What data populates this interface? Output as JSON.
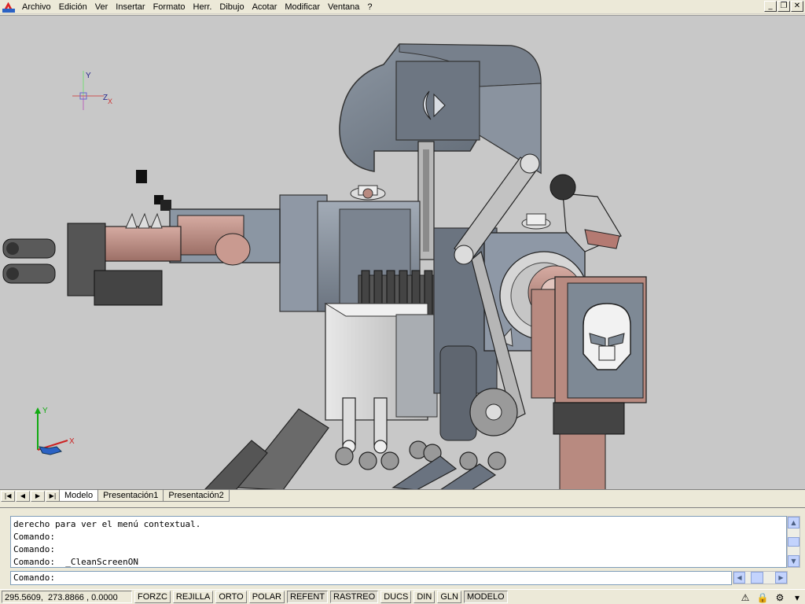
{
  "menu": [
    "Archivo",
    "Edición",
    "Ver",
    "Insertar",
    "Formato",
    "Herr.",
    "Dibujo",
    "Acotar",
    "Modificar",
    "Ventana",
    "?"
  ],
  "window_controls": {
    "minimize": "_",
    "restore": "❐",
    "close": "✕"
  },
  "viewport": {
    "background": "#c8c8c8",
    "ucs_top": {
      "y": "Y",
      "z": "Z",
      "x": "X"
    },
    "ucs_bottom": {
      "y": "Y",
      "x": "X"
    }
  },
  "tab_nav": [
    "|◀",
    "◀",
    "▶",
    "▶|"
  ],
  "tabs": [
    "Modelo",
    "Presentación1",
    "Presentación2"
  ],
  "active_tab": "Modelo",
  "command": {
    "history": [
      "derecho para ver el menú contextual.",
      "Comando:",
      "Comando:",
      "Comando:  _CleanScreenON"
    ],
    "prompt": "Comando:"
  },
  "status": {
    "coords": "295.5609,  273.8866 , 0.0000",
    "toggles": [
      {
        "label": "FORZC",
        "on": false
      },
      {
        "label": "REJILLA",
        "on": false
      },
      {
        "label": "ORTO",
        "on": false
      },
      {
        "label": "POLAR",
        "on": false
      },
      {
        "label": "REFENT",
        "on": true
      },
      {
        "label": "RASTREO",
        "on": true
      },
      {
        "label": "DUCS",
        "on": false
      },
      {
        "label": "DIN",
        "on": false
      },
      {
        "label": "GLN",
        "on": false
      },
      {
        "label": "MODELO",
        "on": true
      }
    ]
  },
  "colors": {
    "accent_blue": "#2b62c4",
    "chrome": "#ece9d8",
    "robot_gray": "#7f8893",
    "robot_copper": "#b88a80"
  }
}
